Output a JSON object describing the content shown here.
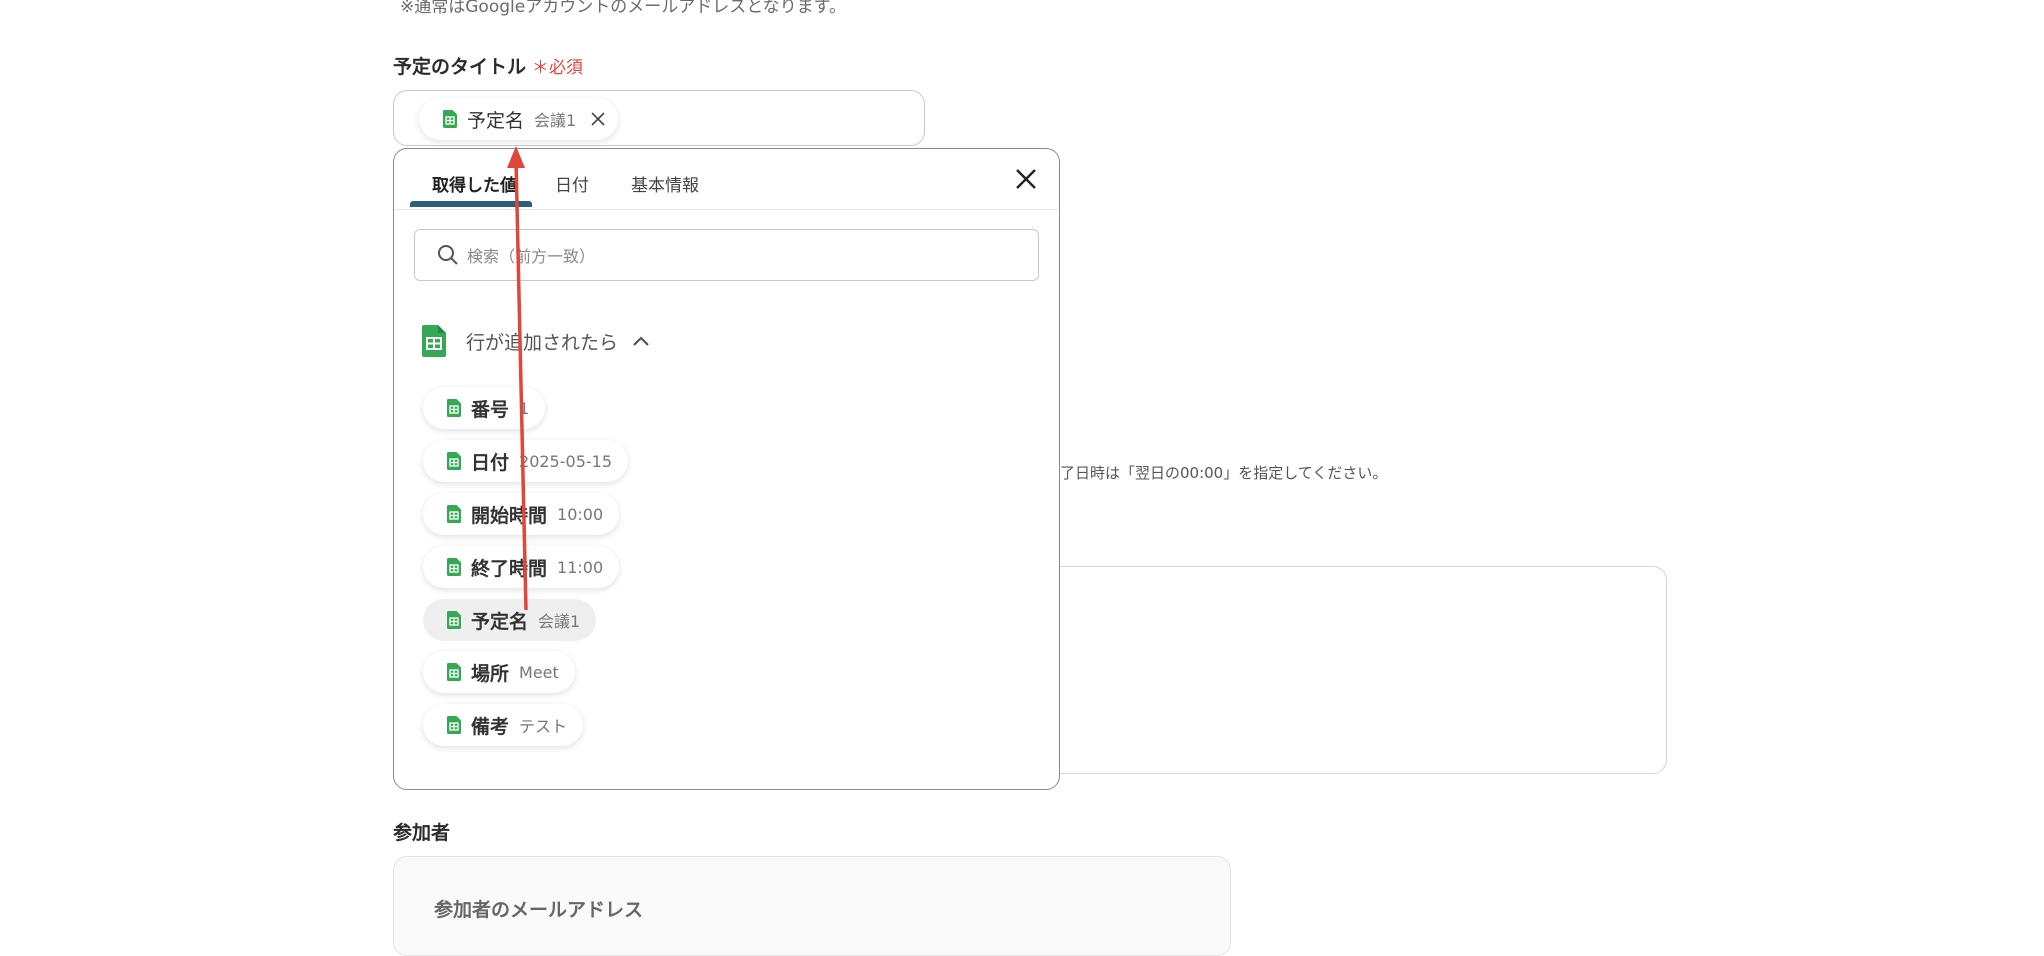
{
  "colors": {
    "required": "#e0463a",
    "tab_underline": "#2a5f7a",
    "sheet_green": "#34a853",
    "arrow": "#e0463a"
  },
  "top_note": "※通常はGoogleアカウントのメールアドレスとなります。",
  "title_field": {
    "label": "予定のタイトル",
    "required_mark": "＊必須",
    "chip": {
      "label": "予定名",
      "value": "会議1",
      "icon": "sheets-icon"
    }
  },
  "popover": {
    "tabs": [
      "取得した値",
      "日付",
      "基本情報"
    ],
    "active_tab": "取得した値",
    "search_placeholder": "検索（前方一致）",
    "group": {
      "label": "行が追加されたら",
      "icon": "sheets-icon",
      "items": [
        {
          "label": "番号",
          "value": "1"
        },
        {
          "label": "日付",
          "value": "2025-05-15"
        },
        {
          "label": "開始時間",
          "value": "10:00"
        },
        {
          "label": "終了時間",
          "value": "11:00"
        },
        {
          "label": "予定名",
          "value": "会議1",
          "selected": true
        },
        {
          "label": "場所",
          "value": "Meet"
        },
        {
          "label": "備考",
          "value": "テスト"
        }
      ]
    }
  },
  "background_note": "了日時は「翌日の00:00」を指定してください。",
  "participants": {
    "label": "参加者",
    "sub_label": "参加者のメールアドレス"
  }
}
